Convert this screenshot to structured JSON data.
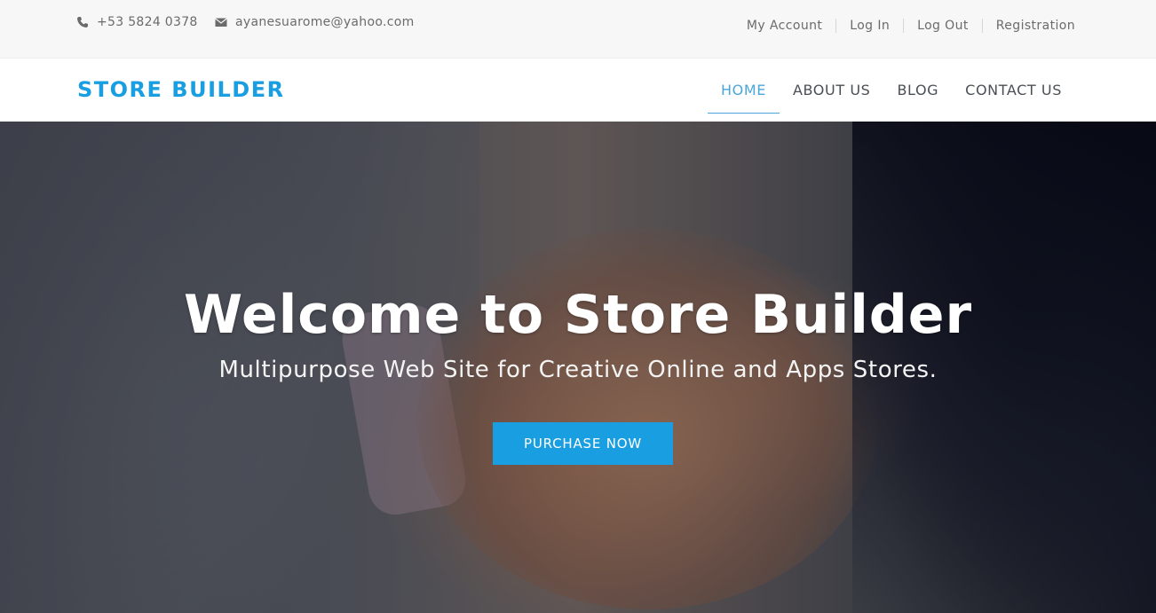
{
  "topbar": {
    "phone": {
      "icon": "phone-icon",
      "text": "+53 5824 0378"
    },
    "email": {
      "icon": "envelope-icon",
      "text": "ayanesuarome@yahoo.com"
    },
    "links": [
      "My Account",
      "Log In",
      "Log Out",
      "Registration"
    ]
  },
  "navbar": {
    "brand": "STORE BUILDER",
    "menu": [
      {
        "label": "HOME",
        "active": true
      },
      {
        "label": "ABOUT US",
        "active": false
      },
      {
        "label": "BLOG",
        "active": false
      },
      {
        "label": "CONTACT US",
        "active": false
      }
    ]
  },
  "hero": {
    "title": "Welcome to Store Builder",
    "subtitle": "Multipurpose Web Site for Creative Online and Apps Stores.",
    "cta_label": "PURCHASE NOW",
    "background": "handshake-photo"
  },
  "colors": {
    "accent": "#1a9ee2",
    "active_link": "#4aa6dc",
    "topbar_bg": "#f7f7f7",
    "text_muted": "#6b6b6b"
  }
}
